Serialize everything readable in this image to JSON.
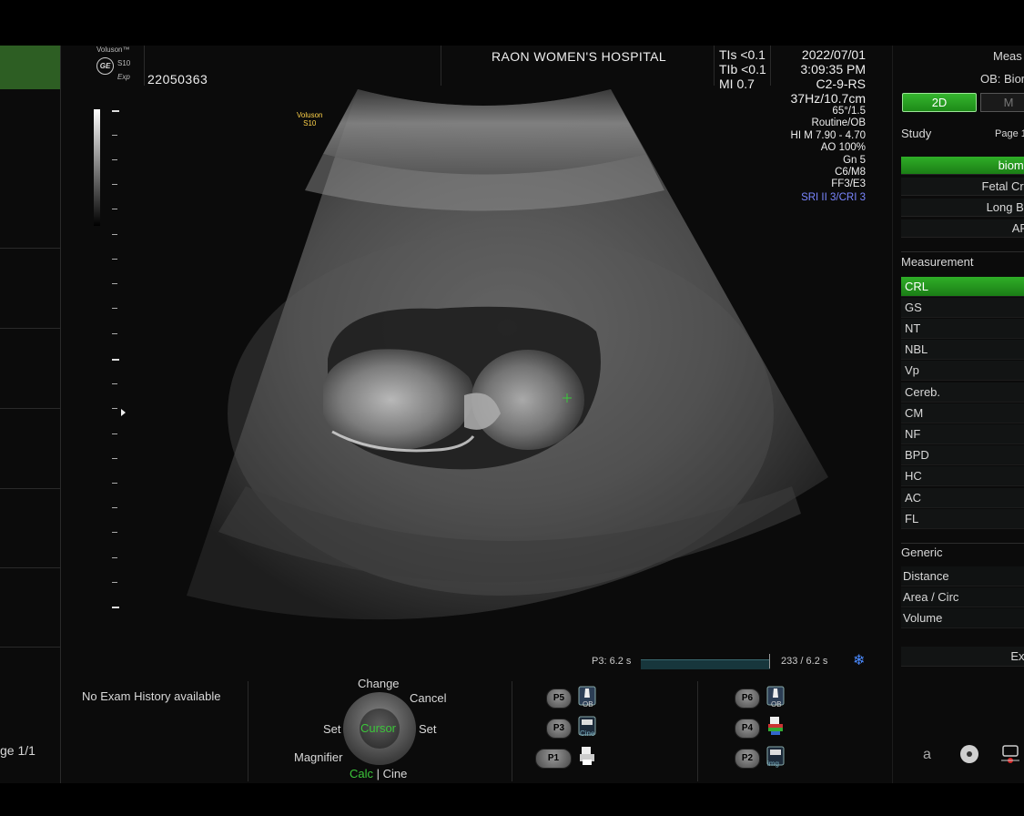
{
  "header": {
    "logo_brand": "Voluson™",
    "logo_ge": "GE",
    "logo_model": "S10",
    "logo_exp": "Exp",
    "patient_id": "22050363",
    "hospital": "RAON WOMEN'S HOSPITAL",
    "safety": {
      "tis": "TIs <0.1",
      "tib": "TIb <0.1",
      "mi": "MI  0.7"
    },
    "params": {
      "date": "2022/07/01",
      "time": "3:09:35 PM",
      "probe": "C2-9-RS",
      "freq_depth": "37Hz/10.7cm",
      "angle": "65°/1.5",
      "preset": "Routine/OB",
      "hi": "HI M  7.90 - 4.70",
      "ao": "AO 100%",
      "gn": "Gn   5",
      "c": "C6/M8",
      "ff": "FF3/E3",
      "sri": "SRI II 3/CRI 3"
    }
  },
  "image": {
    "probe_label_line1": "Voluson",
    "probe_label_line2": "S10"
  },
  "left_panel": {
    "page": "ge 1/1"
  },
  "cine": {
    "label": "P3:  6.2 s",
    "frames": "233 / 6.2 s",
    "progress": 1.0
  },
  "right_panel": {
    "title_top": "Meas",
    "subtitle": "OB: Bior",
    "mode_2d": "2D",
    "mode_m": "M",
    "study_label": "Study",
    "page_label": "Page 1",
    "study_items": [
      "biome",
      "Fetal Cra",
      "Long Bo",
      "AFI"
    ],
    "measurement_label": "Measurement",
    "measurements": [
      "CRL",
      "GS",
      "NT",
      "NBL",
      "Vp",
      "Cereb.",
      "CM",
      "NF",
      "BPD",
      "HC",
      "AC",
      "FL"
    ],
    "generic_label": "Generic",
    "generic_items": [
      "Distance",
      "Area / Circ",
      "Volume"
    ],
    "exit": "Exit"
  },
  "bottom": {
    "exam_history": "No Exam History available",
    "trackball": {
      "change": "Change",
      "cancel": "Cancel",
      "set_left": "Set",
      "set_right": "Set",
      "cursor": "Cursor",
      "magnifier": "Magnifier",
      "calc": "Calc",
      "separator": "|",
      "cine": "Cine"
    },
    "pbuttons": {
      "p5": "P5",
      "p3": "P3",
      "p1": "P1",
      "p6": "P6",
      "p4": "P4",
      "p2": "P2"
    },
    "icon_labels": {
      "ob1": "OB",
      "cine": "Cine",
      "ob2": "OB",
      "img": "img"
    },
    "bottom_right_letter": "a"
  },
  "colors": {
    "accent_green": "#23a11d",
    "sri_blue": "#7a86ff",
    "cursor_green": "#3cc63a",
    "freeze_blue": "#4a8aff"
  }
}
